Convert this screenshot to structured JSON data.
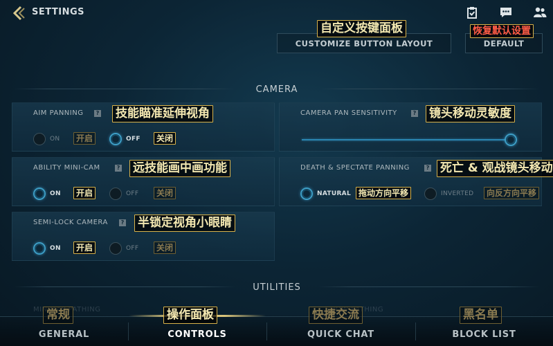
{
  "header": {
    "title": "SETTINGS",
    "icons": [
      "mission-icon",
      "chat-icon",
      "friends-icon"
    ]
  },
  "top_buttons": {
    "customize": {
      "label": "CUSTOMIZE BUTTON LAYOUT",
      "tag": "自定义按键面板"
    },
    "default": {
      "label": "DEFAULT",
      "tag": "恢复默认设置"
    }
  },
  "sections": {
    "camera": "CAMERA",
    "utilities": "UTILITIES"
  },
  "settings": {
    "aim_panning": {
      "label": "AIM PANNING",
      "tag": "技能瞄准延伸视角",
      "on_label": "ON",
      "on_tag": "开启",
      "off_label": "OFF",
      "off_tag": "关闭",
      "selected": "off"
    },
    "camera_pan_sensitivity": {
      "label": "CAMERA PAN SENSITIVITY",
      "tag": "镜头移动灵敏度",
      "value": 1.0
    },
    "ability_mini_cam": {
      "label": "ABILITY MINI-CAM",
      "tag": "远技能画中画功能",
      "on_label": "ON",
      "on_tag": "开启",
      "off_label": "OFF",
      "off_tag": "关闭",
      "selected": "on"
    },
    "death_spectate_panning": {
      "label": "DEATH & SPECTATE PANNING",
      "tag": "死亡 & 观战镜头移动",
      "natural_label": "NATURAL",
      "natural_tag": "拖动方向平移",
      "inverted_label": "INVERTED",
      "inverted_tag": "向反方向平移",
      "selected": "natural"
    },
    "semi_lock_camera": {
      "label": "SEMI-LOCK CAMERA",
      "tag": "半锁定视角小眼睛",
      "on_label": "ON",
      "on_tag": "开启",
      "off_label": "OFF",
      "off_tag": "关闭",
      "selected": "on"
    }
  },
  "utilities_faded": {
    "left": "MINIMAP PATHING",
    "right": "SHOW PATHING"
  },
  "bottom_nav": [
    {
      "label": "GENERAL",
      "tag": "常规",
      "active": false
    },
    {
      "label": "CONTROLS",
      "tag": "操作面板",
      "active": true
    },
    {
      "label": "QUICK CHAT",
      "tag": "快捷交流",
      "active": false
    },
    {
      "label": "BLOCK LIST",
      "tag": "黑名单",
      "active": false
    }
  ],
  "colors": {
    "accent": "#3d9fc7",
    "tag_border": "#d9b24a",
    "tag_text": "#f3e7b0",
    "tag_red": "#ff5b46",
    "background": "#0c2535"
  }
}
